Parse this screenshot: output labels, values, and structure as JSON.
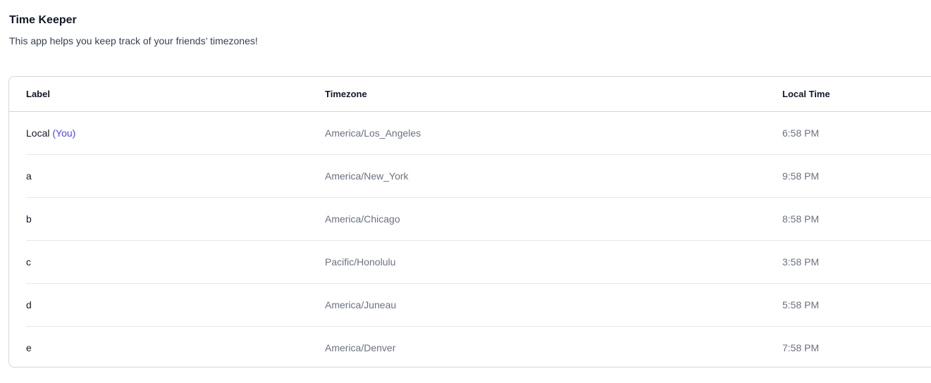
{
  "app": {
    "title": "Time Keeper",
    "subtitle": "This app helps you keep track of your friends’ timezones!"
  },
  "table": {
    "headers": {
      "label": "Label",
      "timezone": "Timezone",
      "local_time": "Local Time"
    },
    "rows": [
      {
        "label": "Local",
        "badge": "(You)",
        "timezone": "America/Los_Angeles",
        "local_time": "6:58 PM"
      },
      {
        "label": "a",
        "timezone": "America/New_York",
        "local_time": "9:58 PM"
      },
      {
        "label": "b",
        "timezone": "America/Chicago",
        "local_time": "8:58 PM"
      },
      {
        "label": "c",
        "timezone": "Pacific/Honolulu",
        "local_time": "3:58 PM"
      },
      {
        "label": "d",
        "timezone": "America/Juneau",
        "local_time": "5:58 PM"
      },
      {
        "label": "e",
        "timezone": "America/Denver",
        "local_time": "7:58 PM"
      }
    ]
  },
  "colors": {
    "accent": "#4f46e5",
    "border": "#d1d5db",
    "muted_text": "#6b7280"
  }
}
